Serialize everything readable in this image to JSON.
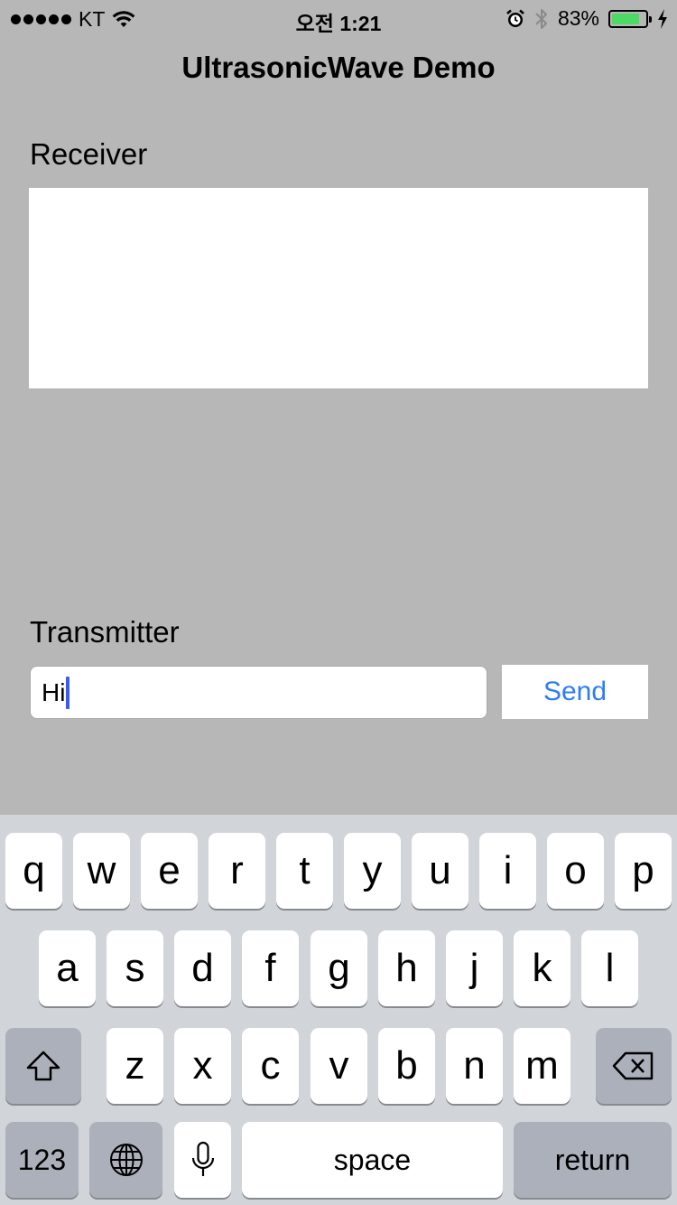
{
  "status_bar": {
    "carrier": "KT",
    "time": "오전 1:21",
    "battery_percent": "83%",
    "battery_level": 0.83,
    "icons": [
      "signal-dots",
      "wifi-icon",
      "alarm-icon",
      "bluetooth-icon",
      "battery-icon",
      "charging-bolt-icon"
    ]
  },
  "nav": {
    "title": "UltrasonicWave Demo"
  },
  "receiver": {
    "label": "Receiver",
    "text": ""
  },
  "transmitter": {
    "label": "Transmitter",
    "input_value": "Hi",
    "send_label": "Send"
  },
  "keyboard": {
    "row1": [
      "q",
      "w",
      "e",
      "r",
      "t",
      "y",
      "u",
      "i",
      "o",
      "p"
    ],
    "row2": [
      "a",
      "s",
      "d",
      "f",
      "g",
      "h",
      "j",
      "k",
      "l"
    ],
    "row3": [
      "z",
      "x",
      "c",
      "v",
      "b",
      "n",
      "m"
    ],
    "numbers_label": "123",
    "space_label": "space",
    "return_label": "return"
  },
  "colors": {
    "background": "#b7b7b7",
    "accent": "#2f7cf6",
    "keyboard_bg": "#d1d4d9",
    "function_key": "#abb0bb",
    "battery_green": "#4cd964"
  }
}
